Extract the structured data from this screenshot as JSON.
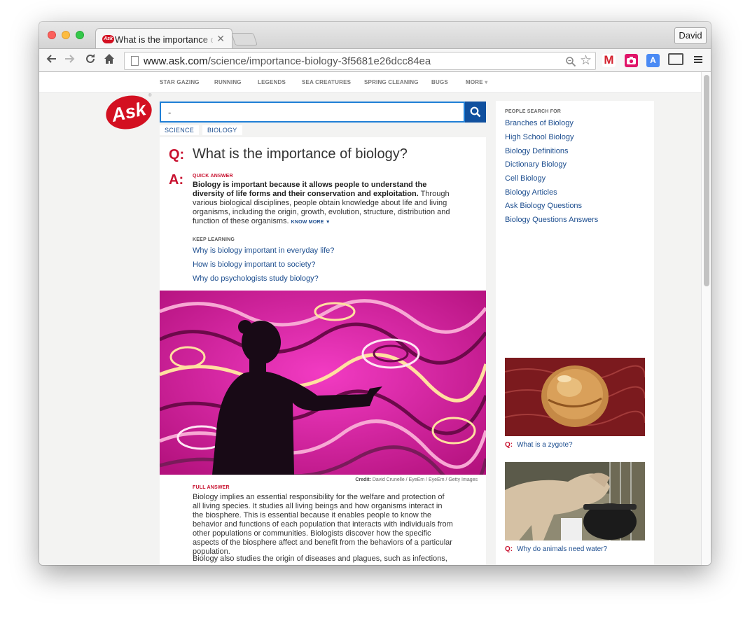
{
  "browser": {
    "tab_title": "What is the importance of biology?",
    "tab_favicon_text": "Ask",
    "profile_name": "David",
    "url_host": "www.ask.com",
    "url_path": "/science/importance-biology-3f5681e26dcc84ea"
  },
  "topnav": {
    "items": [
      "STAR GAZING",
      "RUNNING",
      "LEGENDS",
      "SEA CREATURES",
      "SPRING CLEANING",
      "BUGS",
      "MORE"
    ]
  },
  "logo_text": "Ask",
  "search": {
    "value": "-"
  },
  "breadcrumbs": [
    "SCIENCE",
    "BIOLOGY"
  ],
  "qa": {
    "q_mark": "Q:",
    "question": "What is the importance of biology?",
    "a_mark": "A:",
    "quick_answer_label": "QUICK ANSWER",
    "quick_answer_bold": "Biology is important because it allows people to understand the diversity of life forms and their conservation and exploitation.",
    "quick_answer_rest": " Through various biological disciplines, people obtain knowledge about life and living organisms, including the origin, growth, evolution, structure, distribution and function of these organisms.",
    "know_more": "KNOW MORE",
    "keep_learning_label": "KEEP LEARNING",
    "keep_learning": [
      "Why is biology important in everyday life?",
      "How is biology important to society?",
      "Why do psychologists study biology?"
    ]
  },
  "image_credit": {
    "label": "Credit:",
    "text": "David Crunelle / EyeEm / EyeEm / Getty Images"
  },
  "full_answer": {
    "label": "FULL ANSWER",
    "paragraph1": "Biology implies an essential responsibility for the welfare and protection of all living species. It studies all living beings and how organisms interact in the biosphere. This is essential because it enables people to know the behavior and functions of each population that interacts with individuals from other populations or communities. Biologists discover how the specific aspects of the biosphere affect and benefit from the behaviors of a particular population.",
    "paragraph2": "Biology also studies the origin of diseases and plagues, such as infections,"
  },
  "rail": {
    "label": "PEOPLE SEARCH FOR",
    "links": [
      "Branches of Biology",
      "High School Biology",
      "Biology Definitions",
      "Dictionary Biology",
      "Cell Biology",
      "Biology Articles",
      "Ask Biology Questions",
      "Biology Questions Answers"
    ],
    "related": [
      {
        "q": "Q:",
        "text": "What is a zygote?"
      },
      {
        "q": "Q:",
        "text": "Why do animals need water?"
      }
    ]
  },
  "colors": {
    "ask_red": "#d31021",
    "link_blue": "#1d4e8f",
    "search_blue": "#10509e",
    "qa_red": "#c8102e"
  },
  "icons": [
    "back-icon",
    "forward-icon",
    "reload-icon",
    "home-icon",
    "page-icon",
    "search-icon",
    "star-icon",
    "gmail-icon",
    "camera-icon",
    "translate-icon",
    "cast-icon",
    "menu-icon",
    "close-icon",
    "chevron-down-icon"
  ]
}
